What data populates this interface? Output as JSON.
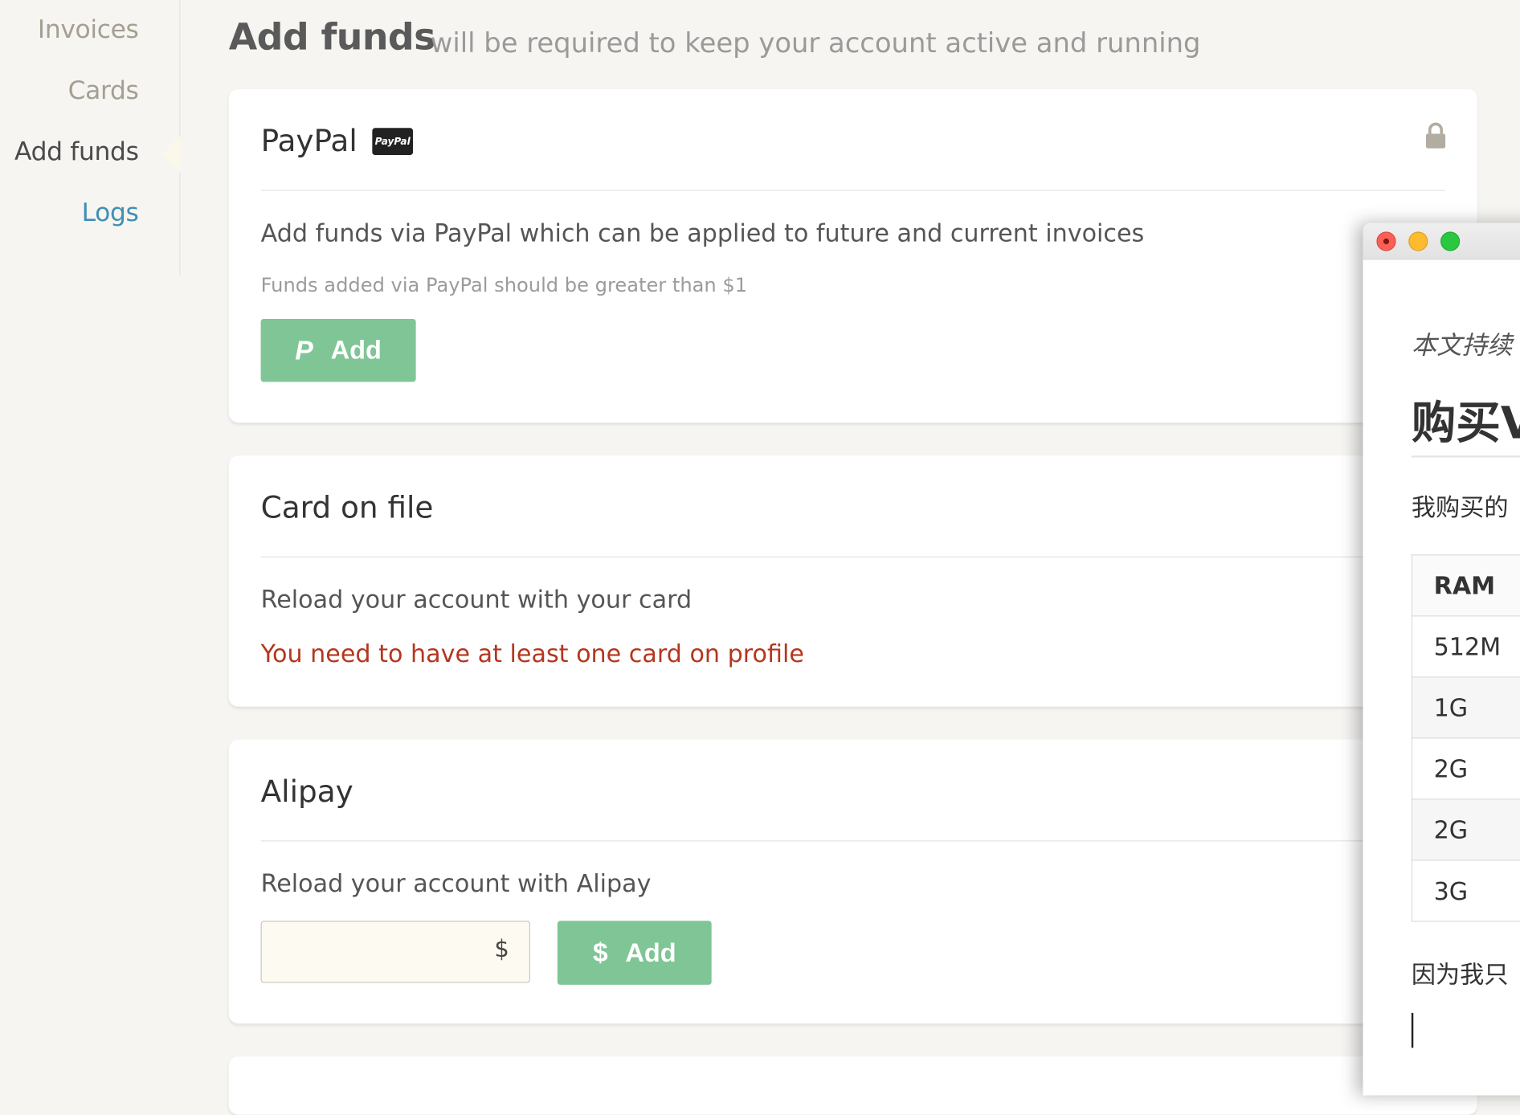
{
  "sidebar": {
    "items": [
      {
        "label": "Invoices"
      },
      {
        "label": "Cards"
      },
      {
        "label": "Add funds"
      },
      {
        "label": "Logs"
      }
    ]
  },
  "header": {
    "title": "Add funds",
    "subtitle": "will be required to keep your account active and running"
  },
  "paypal": {
    "title": "PayPal",
    "badge": "PayPal",
    "description": "Add funds via PayPal which can be applied to future and current invoices",
    "note": "Funds added via PayPal should be greater than $1",
    "button_glyph": "P",
    "button_label": "Add"
  },
  "card_on_file": {
    "title": "Card on file",
    "description": "Reload your account with your card",
    "error": "You need to have at least one card on profile"
  },
  "alipay": {
    "title": "Alipay",
    "description": "Reload your account with Alipay",
    "currency_symbol": "$",
    "button_glyph": "$",
    "button_label": "Add"
  },
  "overlay": {
    "intro": "本文持续",
    "heading": "购买V",
    "paragraph1": "我购买的",
    "table": {
      "header": "RAM",
      "rows": [
        "512M",
        "1G",
        "2G",
        "2G",
        "3G"
      ]
    },
    "paragraph2": "因为我只"
  },
  "colors": {
    "accent_green": "#80c596",
    "link_blue": "#3f8fb5",
    "error_red": "#b5361f"
  }
}
